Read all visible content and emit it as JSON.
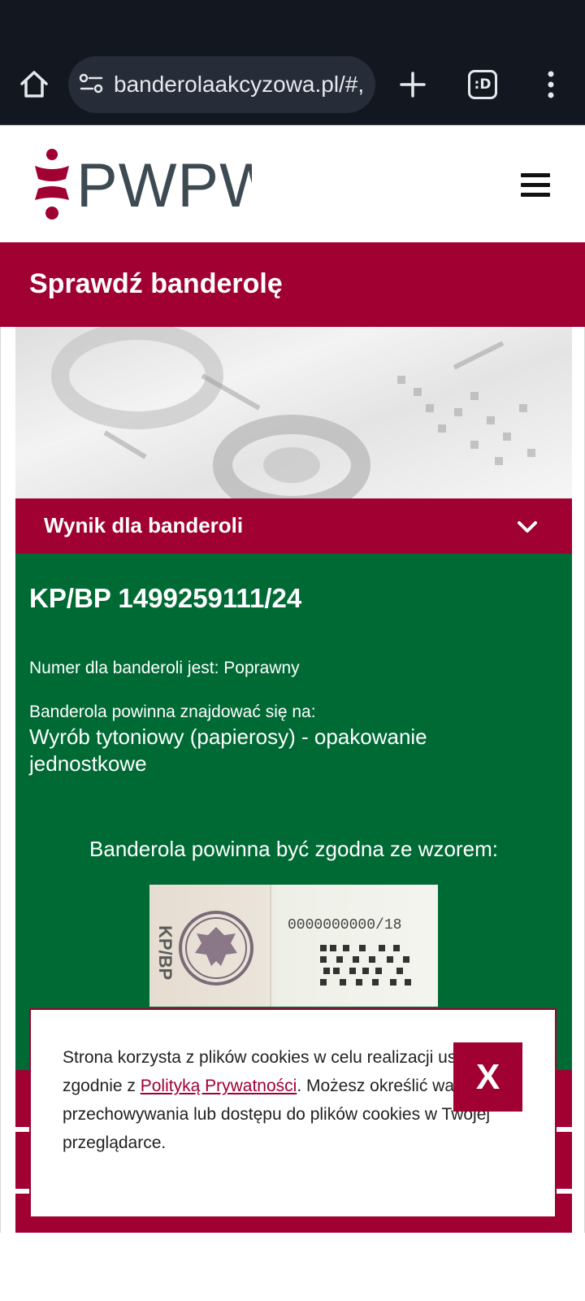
{
  "browser": {
    "url": "banderolaakcyzowa.pl/#,",
    "tabs_label": ":D",
    "icons": [
      "home-icon",
      "site-settings-icon",
      "plus-icon",
      "tabs-icon",
      "more-vert-icon"
    ]
  },
  "header": {
    "logo_text": "PWPW",
    "logo_mark_color": "#a00032",
    "logo_text_color": "#3d4a52",
    "menu_icon": "hamburger-icon"
  },
  "page": {
    "title": "Sprawdź banderolę",
    "accent_color": "#a00032",
    "result_color": "#006a35"
  },
  "result": {
    "header": "Wynik dla banderoli",
    "stamp_number": "KP/BP 1499259111/24",
    "status": "Numer dla banderoli jest: Poprawny",
    "location_label": "Banderola powinna znajdować się na:",
    "location_value": "Wyrób tytoniowy (papierosy) - opakowanie jednostkowe",
    "pattern_heading": "Banderola powinna być zgodna ze wzorem:",
    "sample_stamp": {
      "series": "KP/BP",
      "number": "0000000000/18"
    }
  },
  "cookies": {
    "text_before": "Strona korzysta z plików cookies w celu realizacji usług i zgodnie z ",
    "link": "Polityką Prywatności",
    "text_after": ". Możesz określić warunki przechowywania lub dostępu do plików cookies w Twojej przeglądarce.",
    "close_label": "X"
  }
}
